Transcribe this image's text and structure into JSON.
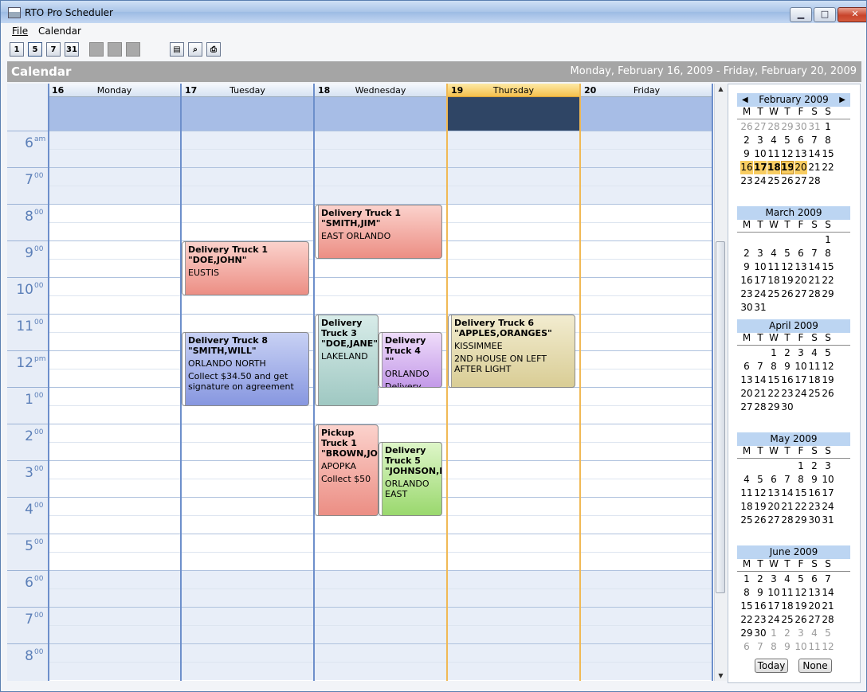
{
  "window": {
    "title": "RTO Pro Scheduler",
    "minimize": "▁",
    "maximize": "□",
    "close": "✕"
  },
  "menu": {
    "file": "File",
    "calendar": "Calendar"
  },
  "toolbar": {
    "day": "1",
    "workweek": "5",
    "week": "7",
    "month": "31"
  },
  "header": {
    "title": "Calendar",
    "range": "Monday, February 16, 2009 - Friday, February 20, 2009"
  },
  "days": [
    {
      "num": "16",
      "name": "Monday"
    },
    {
      "num": "17",
      "name": "Tuesday"
    },
    {
      "num": "18",
      "name": "Wednesday"
    },
    {
      "num": "19",
      "name": "Thursday"
    },
    {
      "num": "20",
      "name": "Friday"
    }
  ],
  "hours": [
    {
      "h": "6",
      "m": "am"
    },
    {
      "h": "7",
      "m": "00"
    },
    {
      "h": "8",
      "m": "00"
    },
    {
      "h": "9",
      "m": "00"
    },
    {
      "h": "10",
      "m": "00"
    },
    {
      "h": "11",
      "m": "00"
    },
    {
      "h": "12",
      "m": "pm"
    },
    {
      "h": "1",
      "m": "00"
    },
    {
      "h": "2",
      "m": "00"
    },
    {
      "h": "3",
      "m": "00"
    },
    {
      "h": "4",
      "m": "00"
    },
    {
      "h": "5",
      "m": "00"
    },
    {
      "h": "6",
      "m": "00"
    },
    {
      "h": "7",
      "m": "00"
    },
    {
      "h": "8",
      "m": "00"
    }
  ],
  "appointments": [
    {
      "title": "Delivery Truck 1",
      "name": "\"SMITH,JIM\"",
      "place": "EAST ORLANDO",
      "note": ""
    },
    {
      "title": "Delivery Truck 1",
      "name": "\"DOE,JOHN\"",
      "place": "EUSTIS",
      "note": ""
    },
    {
      "title": "Delivery Truck 8",
      "name": "\"SMITH,WILL\"",
      "place": "ORLANDO NORTH",
      "note": "Collect $34.50 and get signature on agreement"
    },
    {
      "title": "Delivery Truck 3",
      "name": "\"DOE,JANE\"",
      "place": "LAKELAND",
      "note": ""
    },
    {
      "title": "Delivery Truck 4",
      "name": "\"\"",
      "place": "ORLANDO",
      "note": "Delivery"
    },
    {
      "title": "Delivery Truck 6",
      "name": "\"APPLES,ORANGES\"",
      "place": "KISSIMMEE",
      "note": "2ND HOUSE ON LEFT AFTER LIGHT"
    },
    {
      "title": "Pickup Truck 1",
      "name": "\"BROWN,JOE\"",
      "place": "APOPKA",
      "note": "Collect $50"
    },
    {
      "title": "Delivery Truck 5",
      "name": "\"JOHNSON,LARRY\"",
      "place": "ORLANDO EAST",
      "note": ""
    }
  ],
  "minical": {
    "dow": [
      "M",
      "T",
      "W",
      "T",
      "F",
      "S",
      "S"
    ],
    "months": [
      {
        "name": "February 2009",
        "prev_days": [
          "26",
          "27",
          "28",
          "29",
          "30",
          "31"
        ],
        "start": 6,
        "days": 28,
        "after": 0
      },
      {
        "name": "March 2009",
        "prev_days": [],
        "start": 6,
        "days": 31,
        "after": 0
      },
      {
        "name": "April 2009",
        "prev_days": [],
        "start": 2,
        "days": 30,
        "after": 0
      },
      {
        "name": "May 2009",
        "prev_days": [],
        "start": 4,
        "days": 31,
        "after": 0
      },
      {
        "name": "June 2009",
        "prev_days": [],
        "start": 0,
        "days": 30,
        "after": 12
      }
    ],
    "today_button": "Today",
    "none_button": "None"
  }
}
